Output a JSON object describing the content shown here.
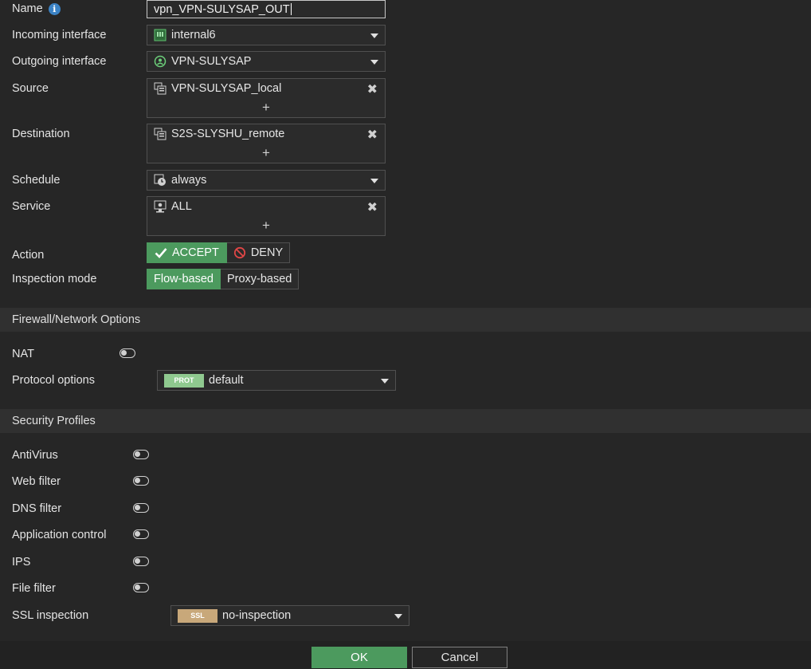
{
  "form": {
    "name_label": "Name",
    "name_value": "vpn_VPN-SULYSAP_OUT",
    "incoming_label": "Incoming interface",
    "incoming_value": "internal6",
    "outgoing_label": "Outgoing interface",
    "outgoing_value": "VPN-SULYSAP",
    "source_label": "Source",
    "source_value": "VPN-SULYSAP_local",
    "destination_label": "Destination",
    "destination_value": "S2S-SLYSHU_remote",
    "schedule_label": "Schedule",
    "schedule_value": "always",
    "service_label": "Service",
    "service_value": "ALL",
    "action_label": "Action",
    "action_accept": "ACCEPT",
    "action_deny": "DENY",
    "inspection_label": "Inspection mode",
    "inspection_flow": "Flow-based",
    "inspection_proxy": "Proxy-based",
    "remove_glyph": "✖",
    "add_glyph": "+"
  },
  "firewall": {
    "section_title": "Firewall/Network Options",
    "nat_label": "NAT",
    "nat_enabled": false,
    "protocol_label": "Protocol options",
    "protocol_tag": "PROT",
    "protocol_value": "default"
  },
  "security": {
    "section_title": "Security Profiles",
    "antivirus_label": "AntiVirus",
    "webfilter_label": "Web filter",
    "dnsfilter_label": "DNS filter",
    "appcontrol_label": "Application control",
    "ips_label": "IPS",
    "filefilter_label": "File filter",
    "ssl_label": "SSL inspection",
    "ssl_tag": "SSL",
    "ssl_value": "no-inspection"
  },
  "footer": {
    "ok_label": "OK",
    "cancel_label": "Cancel"
  },
  "colors": {
    "accent_green": "#4c9a5e",
    "prot_tag": "#8fc98f",
    "ssl_tag": "#c8a87a",
    "info_icon": "#3b82c4"
  }
}
